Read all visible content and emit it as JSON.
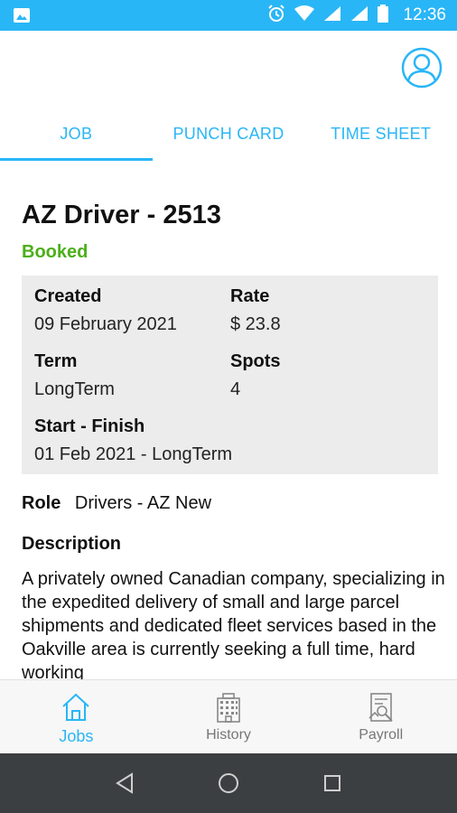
{
  "status_bar": {
    "time": "12:36"
  },
  "tabs": [
    {
      "label": "JOB",
      "active": true
    },
    {
      "label": "PUNCH CARD",
      "active": false
    },
    {
      "label": "TIME SHEET",
      "active": false
    }
  ],
  "job": {
    "title": "AZ Driver - 2513",
    "status": "Booked",
    "status_color": "#4caf1a",
    "details": {
      "created_label": "Created",
      "created_value": "09 February 2021",
      "rate_label": "Rate",
      "rate_value": "$ 23.8",
      "term_label": "Term",
      "term_value": "LongTerm",
      "spots_label": "Spots",
      "spots_value": "4",
      "start_finish_label": "Start - Finish",
      "start_finish_value": "01 Feb 2021 - LongTerm"
    },
    "role_label": "Role",
    "role_value": "Drivers - AZ New",
    "description_label": "Description",
    "description_text": "A privately owned Canadian company, specializing in the expedited delivery of small and large parcel shipments and dedicated fleet services based in the Oakville area is currently seeking a full time, hard working"
  },
  "bottom_nav": [
    {
      "label": "Jobs",
      "icon": "home-icon",
      "active": true
    },
    {
      "label": "History",
      "icon": "building-icon",
      "active": false
    },
    {
      "label": "Payroll",
      "icon": "payroll-icon",
      "active": false
    }
  ],
  "colors": {
    "accent": "#29b6f6",
    "booked": "#4caf1a",
    "info_bg": "#ececec",
    "system_nav": "#3c3f41"
  }
}
